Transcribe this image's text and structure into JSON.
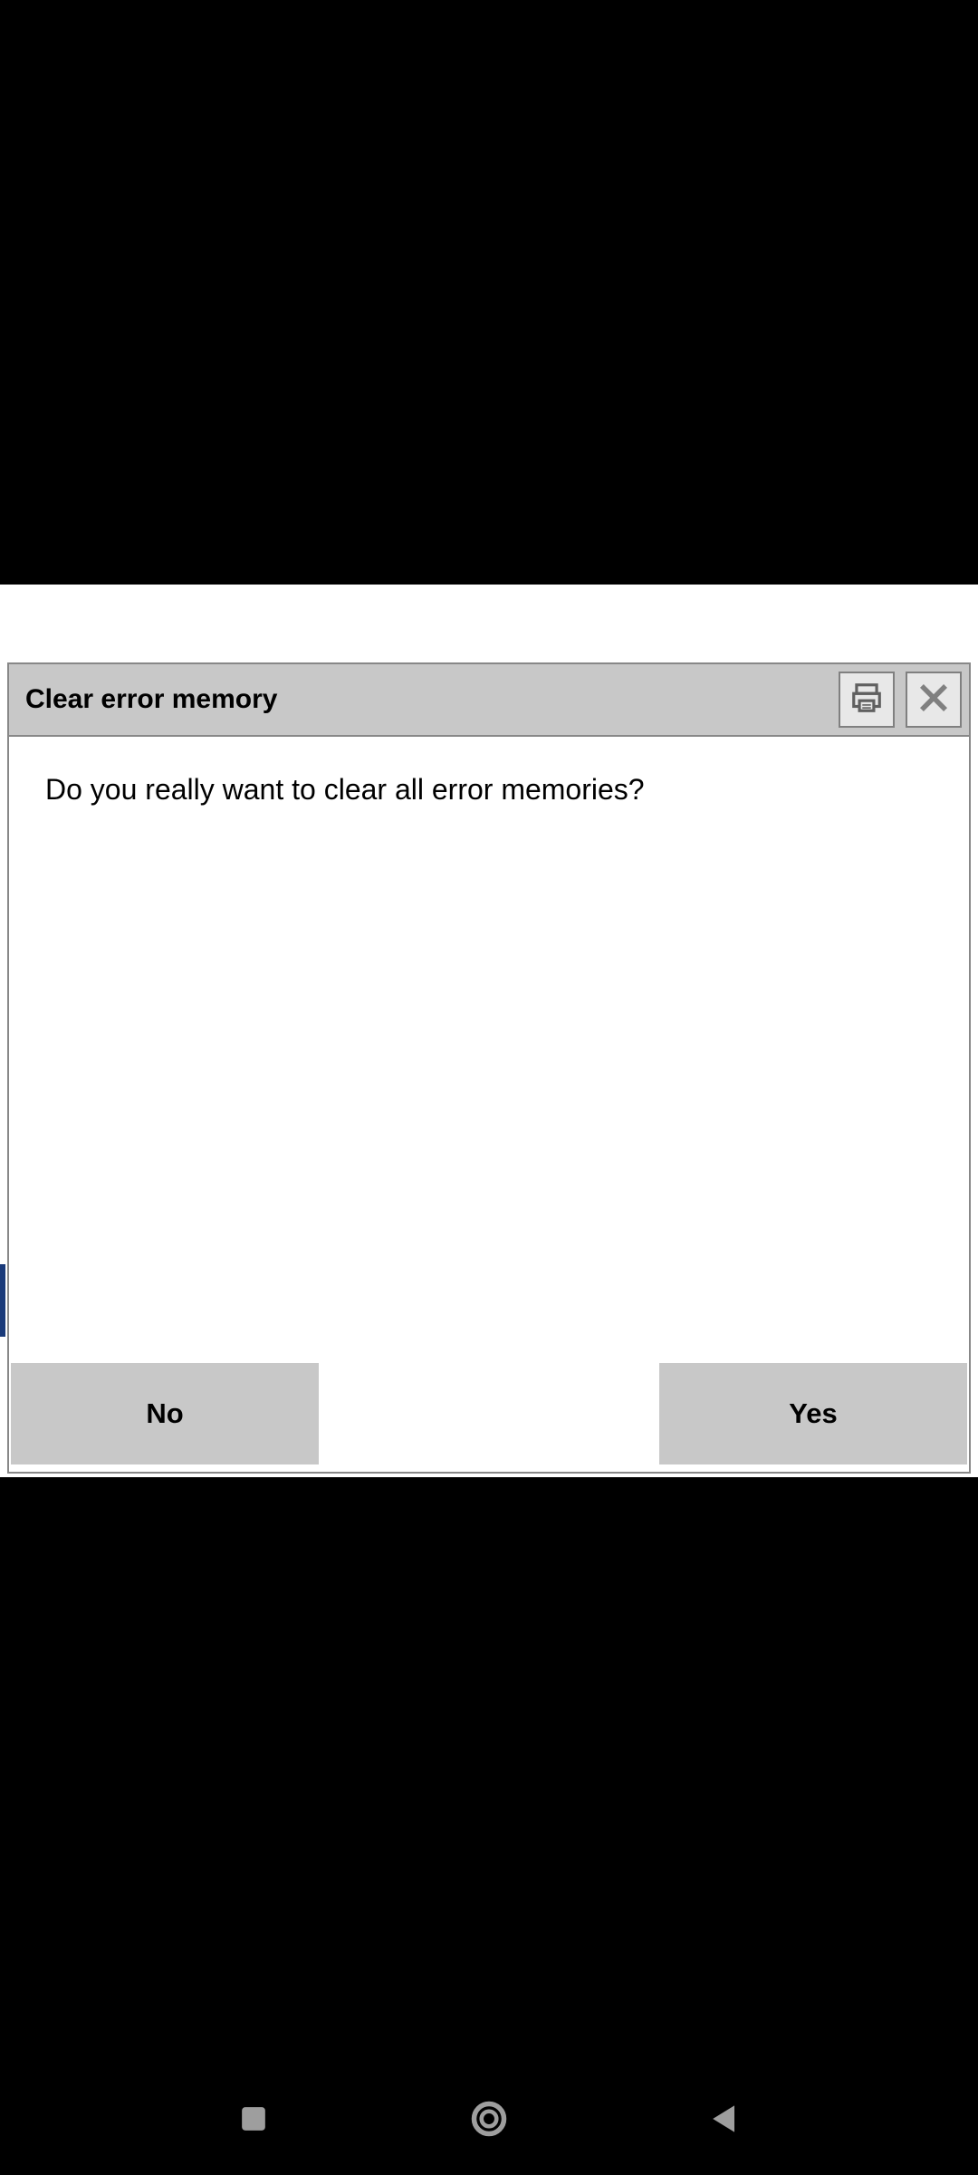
{
  "dialog": {
    "title": "Clear error memory",
    "message": "Do you really want to clear all error memories?",
    "no_label": "No",
    "yes_label": "Yes"
  }
}
